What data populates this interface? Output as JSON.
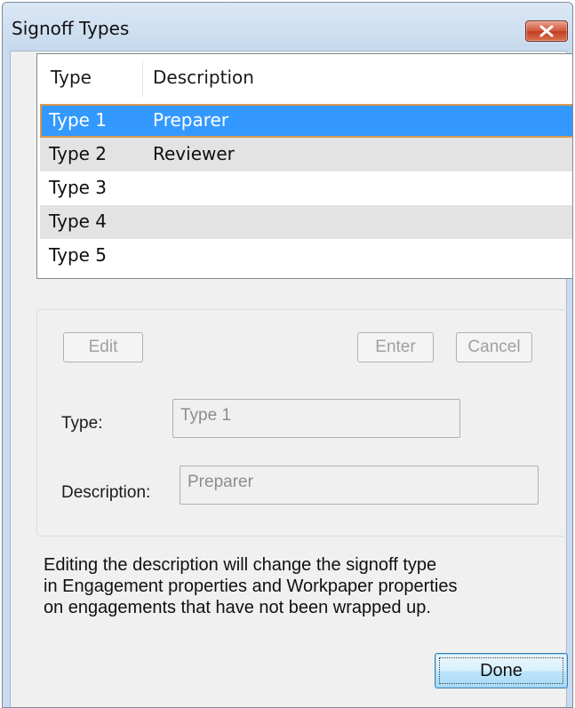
{
  "window": {
    "title": "Signoff Types"
  },
  "list": {
    "columns": [
      "Type",
      "Description"
    ],
    "rows": [
      {
        "type": "Type 1",
        "description": "Preparer"
      },
      {
        "type": "Type 2",
        "description": "Reviewer"
      },
      {
        "type": "Type 3",
        "description": ""
      },
      {
        "type": "Type 4",
        "description": ""
      },
      {
        "type": "Type 5",
        "description": ""
      }
    ],
    "selected_index": 0
  },
  "edit_group": {
    "edit_label": "Edit",
    "enter_label": "Enter",
    "cancel_label": "Cancel",
    "type_label": "Type:",
    "type_value": "Type 1",
    "description_label": "Description:",
    "description_value": "Preparer"
  },
  "note": {
    "lines": [
      "Editing the description will change the signoff type",
      "in Engagement properties and Workpaper properties",
      "on engagements that have not been wrapped up."
    ]
  },
  "footer": {
    "done_label": "Done"
  },
  "colors": {
    "selection": "#3399ff",
    "selection_border": "#d89a50",
    "close_button": "#c94b32"
  },
  "icons": {
    "close": "close-x-icon"
  }
}
